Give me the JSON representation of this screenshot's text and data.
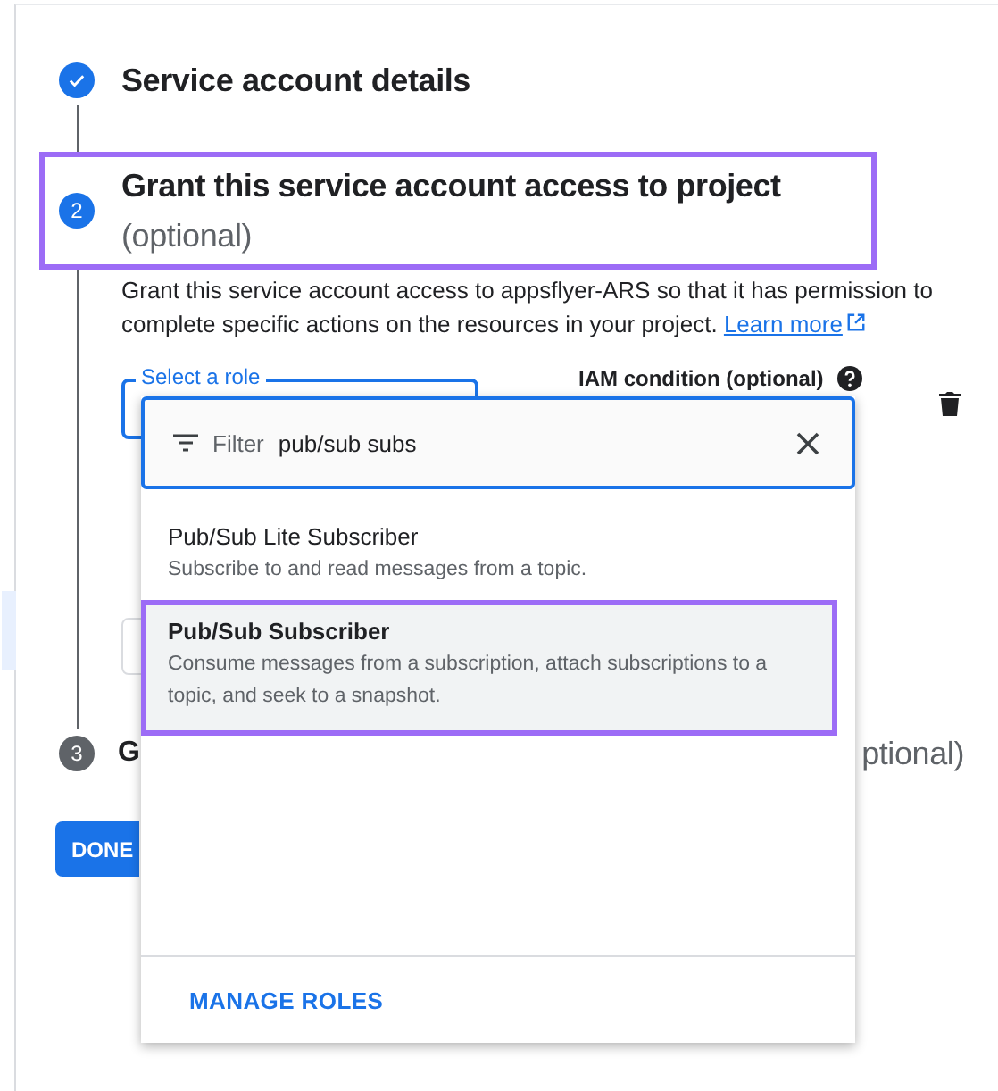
{
  "steps": [
    {
      "kind": "complete",
      "title": "Service account details",
      "highlighted": false
    },
    {
      "kind": "active",
      "number": "2",
      "title": "Grant this service account access to project",
      "optional": "(optional)",
      "highlighted": true,
      "description": {
        "text": "Grant this service account access to appsflyer-ARS so that it has permission to complete specific actions on the resources in your project.",
        "link": "Learn more"
      },
      "role_row": {
        "field_label": "Select a role",
        "condition_label": "IAM condition (optional)"
      }
    },
    {
      "kind": "inactive",
      "number": "3",
      "title": "G",
      "optional": "ptional)",
      "highlighted": false
    }
  ],
  "done_button": "DONE",
  "dropdown": {
    "filter_label": "Filter",
    "filter_value": "pub/sub subs",
    "items": [
      {
        "title": "Pub/Sub Lite Subscriber",
        "description": "Subscribe to and read messages from a topic.",
        "selected": false,
        "highlighted": false
      },
      {
        "title": "Pub/Sub Subscriber",
        "description": "Consume messages from a subscription, attach subscriptions to a topic, and seek to a snapshot.",
        "selected": true,
        "highlighted": true
      }
    ],
    "footer_link": "MANAGE ROLES"
  }
}
